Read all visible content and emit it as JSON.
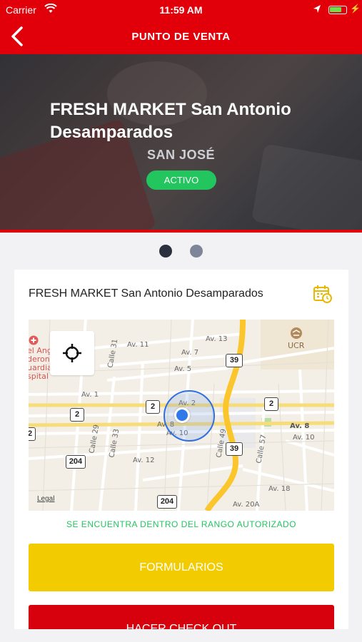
{
  "status_bar": {
    "carrier": "Carrier",
    "time": "11:59 AM"
  },
  "nav": {
    "title": "PUNTO DE VENTA"
  },
  "hero": {
    "title": "FRESH MARKET San Antonio Desamparados",
    "region": "SAN JOSÉ",
    "status_badge": "ACTIVO"
  },
  "pager": {
    "count": 2,
    "active_index": 0
  },
  "store_card": {
    "name": "FRESH MARKET San Antonio Desamparados",
    "map": {
      "streets": [
        "Av. 13",
        "Av. 11",
        "Av. 7",
        "Av. 5",
        "Av. 1",
        "Av. 2",
        "Av. 8",
        "Av. 10",
        "Av. 12",
        "Av. 18",
        "Av. 20A",
        "Av. 8",
        "Av. 10",
        "Calle 31",
        "Calle 29",
        "Calle 33",
        "Calle 49",
        "Calle 57"
      ],
      "route_shields": [
        "39",
        "2",
        "2",
        "2",
        "39",
        "204",
        "204",
        "2"
      ],
      "poi_ucr": "UCR",
      "poi_hospital": "el Ang\nderon\nuardia\nspital",
      "legal": "Legal"
    },
    "range_status": "SE ENCUENTRA DENTRO DEL RANGO AUTORIZADO",
    "forms_button": "FORMULARIOS",
    "checkout_button": "HACER CHECK OUT"
  },
  "colors": {
    "brand_red": "#e10009",
    "status_green": "#22c55e",
    "forms_yellow": "#f2cc00",
    "pager_active": "#2b2f3e",
    "pager_inactive": "#7d8598",
    "location_blue": "#2f6fe0"
  },
  "icons": {
    "back": "chevron-left-icon",
    "calendar": "calendar-clock-icon",
    "locate": "crosshair-icon",
    "wifi": "wifi-icon",
    "location": "location-arrow-icon",
    "battery": "battery-icon"
  }
}
